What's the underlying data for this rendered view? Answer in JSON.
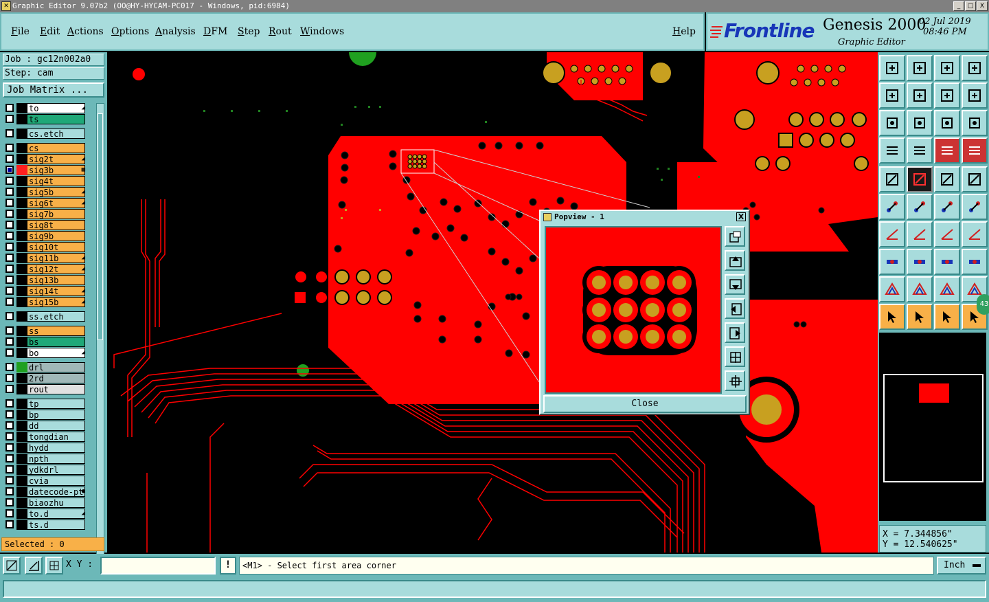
{
  "window": {
    "title": "Graphic Editor 9.07b2 (OO@HY-HYCAM-PC017 - Windows, pid:6984)",
    "controls": [
      "_",
      "□",
      "X"
    ]
  },
  "menu": {
    "items": [
      "File",
      "Edit",
      "Actions",
      "Options",
      "Analysis",
      "DFM",
      "Step",
      "Rout",
      "Windows"
    ],
    "help": "Help"
  },
  "brand": {
    "logo": "Frontline",
    "product": "Genesis 2000",
    "date": "02 Jul 2019",
    "time": "08:46 PM",
    "subtitle": "Graphic Editor"
  },
  "job": {
    "job_line": "Job : gc12n002a0",
    "step_line": "Step: cam",
    "matrix_button": "Job Matrix ..."
  },
  "layers": [
    {
      "name": "to",
      "color": "#ffffff",
      "swatch": "#000000",
      "mark": "◢"
    },
    {
      "name": "ts",
      "color": "#20a878",
      "swatch": "#000000",
      "mark": ""
    },
    {
      "name": "cs.etch",
      "color": "#a8dcdc",
      "swatch": "#000000",
      "mark": ""
    },
    {
      "name": "cs",
      "color": "#f8b048",
      "swatch": "#000000",
      "mark": ""
    },
    {
      "name": "sig2t",
      "color": "#f8b048",
      "swatch": "#000000",
      "mark": "◢"
    },
    {
      "name": "sig3b",
      "color": "#f8b048",
      "swatch": "#ff2020",
      "mark": "▦",
      "on": true
    },
    {
      "name": "sig4t",
      "color": "#f8b048",
      "swatch": "#000000",
      "mark": ""
    },
    {
      "name": "sig5b",
      "color": "#f8b048",
      "swatch": "#000000",
      "mark": "◢"
    },
    {
      "name": "sig6t",
      "color": "#f8b048",
      "swatch": "#000000",
      "mark": "◢"
    },
    {
      "name": "sig7b",
      "color": "#f8b048",
      "swatch": "#000000",
      "mark": ""
    },
    {
      "name": "sig8t",
      "color": "#f8b048",
      "swatch": "#000000",
      "mark": ""
    },
    {
      "name": "sig9b",
      "color": "#f8b048",
      "swatch": "#000000",
      "mark": ""
    },
    {
      "name": "sig10t",
      "color": "#f8b048",
      "swatch": "#000000",
      "mark": ""
    },
    {
      "name": "sig11b",
      "color": "#f8b048",
      "swatch": "#000000",
      "mark": "◢"
    },
    {
      "name": "sig12t",
      "color": "#f8b048",
      "swatch": "#000000",
      "mark": "◢"
    },
    {
      "name": "sig13b",
      "color": "#f8b048",
      "swatch": "#000000",
      "mark": ""
    },
    {
      "name": "sig14t",
      "color": "#f8b048",
      "swatch": "#000000",
      "mark": "◢"
    },
    {
      "name": "sig15b",
      "color": "#f8b048",
      "swatch": "#000000",
      "mark": "◢"
    },
    {
      "name": "ss.etch",
      "color": "#a8dcdc",
      "swatch": "#000000",
      "mark": ""
    },
    {
      "name": "ss",
      "color": "#f8b048",
      "swatch": "#000000",
      "mark": ""
    },
    {
      "name": "bs",
      "color": "#20a878",
      "swatch": "#000000",
      "mark": ""
    },
    {
      "name": "bo",
      "color": "#ffffff",
      "swatch": "#000000",
      "mark": "◢"
    },
    {
      "name": "drl",
      "color": "#a0b8b8",
      "swatch": "#20a020",
      "mark": ""
    },
    {
      "name": "2rd",
      "color": "#a0b8b8",
      "swatch": "#000000",
      "mark": ""
    },
    {
      "name": "rout",
      "color": "#e0e0e0",
      "swatch": "#000000",
      "mark": ""
    },
    {
      "name": "tp",
      "color": "#a8dcdc",
      "swatch": "#000000",
      "mark": ""
    },
    {
      "name": "bp",
      "color": "#a8dcdc",
      "swatch": "#000000",
      "mark": ""
    },
    {
      "name": "dd",
      "color": "#a8dcdc",
      "swatch": "#000000",
      "mark": ""
    },
    {
      "name": "tongdian",
      "color": "#a8dcdc",
      "swatch": "#000000",
      "mark": ""
    },
    {
      "name": "hydd",
      "color": "#a8dcdc",
      "swatch": "#000000",
      "mark": ""
    },
    {
      "name": "npth",
      "color": "#a8dcdc",
      "swatch": "#000000",
      "mark": ""
    },
    {
      "name": "ydkdrl",
      "color": "#a8dcdc",
      "swatch": "#000000",
      "mark": ""
    },
    {
      "name": "cvia",
      "color": "#a8dcdc",
      "swatch": "#000000",
      "mark": ""
    },
    {
      "name": "datecode-pt",
      "color": "#a8dcdc",
      "swatch": "#000000",
      "mark": "●"
    },
    {
      "name": "biaozhu",
      "color": "#a8dcdc",
      "swatch": "#000000",
      "mark": ""
    },
    {
      "name": "to.d",
      "color": "#a8dcdc",
      "swatch": "#000000",
      "mark": "◢"
    },
    {
      "name": "ts.d",
      "color": "#a8dcdc",
      "swatch": "#000000",
      "mark": ""
    }
  ],
  "selected": "Selected : 0",
  "popview": {
    "title": "Popview - 1",
    "close_label": "Close",
    "close_x": "X"
  },
  "coords": {
    "x": "X = 7.344856\"",
    "y": "Y = 12.540625\""
  },
  "badge": "43",
  "bottom": {
    "xy_label": "X Y :",
    "xy_value": "",
    "msg_icon": "!",
    "message": "<M1> - Select first area corner",
    "units": "Inch"
  },
  "colors": {
    "copper": "#ff0000",
    "pad": "#c8a020",
    "panel": "#a8dcdc",
    "panel_dark": "#6cb8b8",
    "highlight": "#f8b048"
  }
}
